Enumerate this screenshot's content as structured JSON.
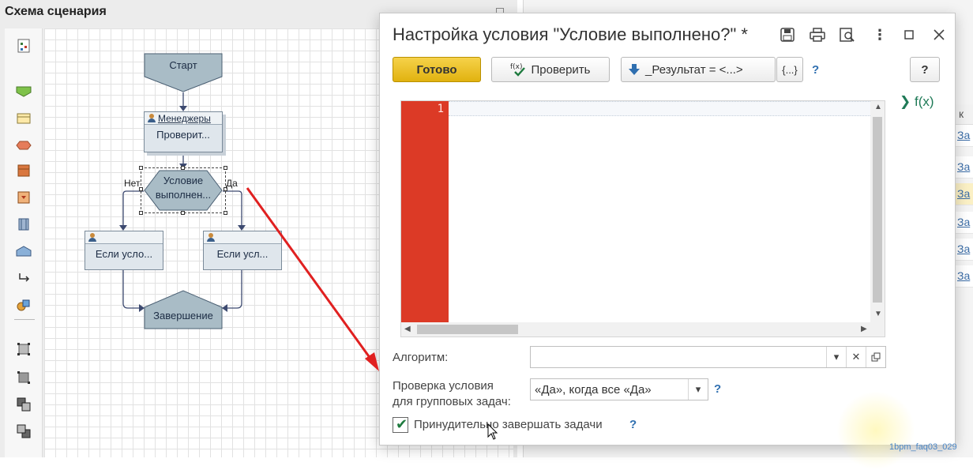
{
  "scheme": {
    "title": "Схема сценария",
    "nodes": {
      "start": "Старт",
      "task_performer": "Менеджеры",
      "task_name": "Проверит...",
      "condition_line1": "Условие",
      "condition_line2": "выполнен...",
      "branch_no": "Нет",
      "branch_yes": "Да",
      "left_performer": "",
      "left_task": "Если усло...",
      "right_performer": "",
      "right_task": "Если усл...",
      "end": "Завершение"
    },
    "colors": {
      "node_fill": "#a9bcc6",
      "node_stroke": "#4a5f73",
      "edge": "#3d4a70"
    }
  },
  "background_list": {
    "header": "к",
    "rows": [
      "За",
      "За",
      "За",
      "За",
      "За",
      "За"
    ],
    "selected_row": 2
  },
  "dialog": {
    "title": "Настройка условия \"Условие выполнено?\" *",
    "toolbar": {
      "done": "Готово",
      "check": "Проверить",
      "result_insert": "_Результат = <...>",
      "braces": "{...}",
      "help": "?",
      "help_button": "?"
    },
    "fx": "f(x)",
    "editor": {
      "line_number": "1",
      "gutter_color": "#dc3a26"
    },
    "algorithm": {
      "label": "Алгоритм:",
      "value": ""
    },
    "group_check": {
      "label_line1": "Проверка условия",
      "label_line2": "для групповых задач:",
      "value": "«Да», когда все «Да»",
      "help": "?"
    },
    "force_complete": {
      "label": "Принудительно завершать задачи",
      "checked": true,
      "help": "?"
    }
  },
  "watermark": "1bpm_faq03_029"
}
